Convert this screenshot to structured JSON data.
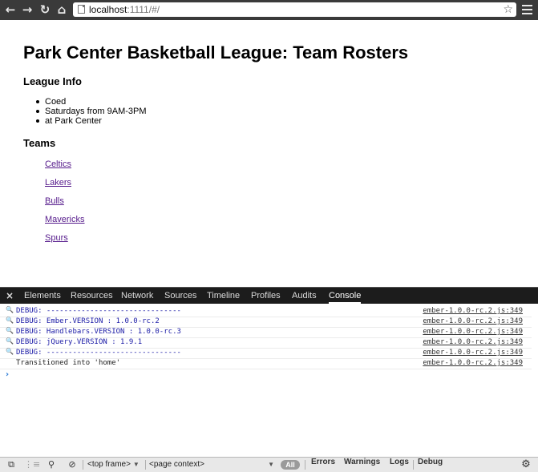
{
  "browser": {
    "url_host": "localhost",
    "url_rest": ":1111/#/",
    "icons": {
      "back": "←",
      "forward": "→",
      "reload": "↻",
      "home": "⌂",
      "star": "☆"
    }
  },
  "page": {
    "title": "Park Center Basketball League: Team Rosters",
    "info_heading": "League Info",
    "info_items": [
      "Coed",
      "Saturdays from 9AM-3PM",
      "at Park Center"
    ],
    "teams_heading": "Teams",
    "teams": [
      "Celtics",
      "Lakers",
      "Bulls",
      "Mavericks",
      "Spurs"
    ]
  },
  "devtools": {
    "close_label": "×",
    "tabs": [
      "Elements",
      "Resources",
      "Network",
      "Sources",
      "Timeline",
      "Profiles",
      "Audits",
      "Console"
    ],
    "active_tab": "Console",
    "logs": [
      {
        "message": "DEBUG: -------------------------------",
        "source": "ember-1.0.0-rc.2.js:349",
        "kind": "debug"
      },
      {
        "message": "DEBUG: Ember.VERSION : 1.0.0-rc.2",
        "source": "ember-1.0.0-rc.2.js:349",
        "kind": "debug"
      },
      {
        "message": "DEBUG: Handlebars.VERSION : 1.0.0-rc.3",
        "source": "ember-1.0.0-rc.2.js:349",
        "kind": "debug"
      },
      {
        "message": "DEBUG: jQuery.VERSION : 1.9.1",
        "source": "ember-1.0.0-rc.2.js:349",
        "kind": "debug"
      },
      {
        "message": "DEBUG: -------------------------------",
        "source": "ember-1.0.0-rc.2.js:349",
        "kind": "debug"
      },
      {
        "message": "Transitioned into 'home'",
        "source": "ember-1.0.0-rc.2.js:349",
        "kind": "log"
      }
    ],
    "prompt_symbol": "›",
    "status": {
      "frame_select": "<top frame>",
      "context_select": "<page context>",
      "all_label": "All",
      "filters": [
        "Errors",
        "Warnings",
        "Logs",
        "Debug"
      ]
    }
  }
}
